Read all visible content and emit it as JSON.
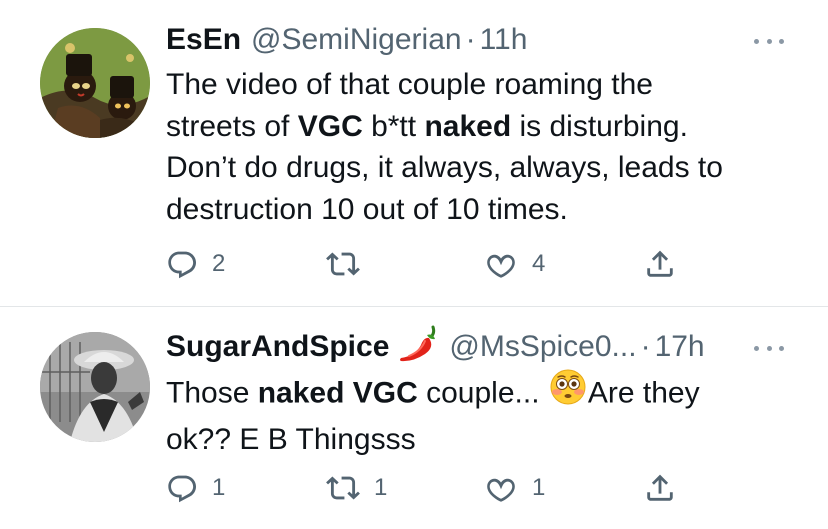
{
  "tweets": [
    {
      "display_name": "EsEn",
      "handle": "@SemiNigerian",
      "separator": "·",
      "time": "11h",
      "text": {
        "l1": "The video of that couple roaming the",
        "l2a": "streets of ",
        "l2b": "VGC",
        "l2c": " b*tt ",
        "l2d": "naked",
        "l2e": " is disturbing.",
        "l3": "Don’t do drugs, it always, always, leads to",
        "l4": "destruction 10 out of 10 times."
      },
      "replies": "2",
      "retweets": "",
      "likes": "4"
    },
    {
      "display_name": "SugarAndSpice",
      "name_emoji": "chili-pepper-icon",
      "handle": "@MsSpice0...",
      "separator": "·",
      "time": "17h",
      "text": {
        "l1a": "Those ",
        "l1b": "naked VGC",
        "l1c": " couple... ",
        "l1d": "Are they",
        "l2": "ok?? E B Thingsss"
      },
      "replies": "1",
      "retweets": "1",
      "likes": "1"
    }
  ],
  "colors": {
    "text": "#0f1419",
    "secondary": "#536471",
    "divider": "#e3e6e8",
    "background": "#ffffff"
  }
}
